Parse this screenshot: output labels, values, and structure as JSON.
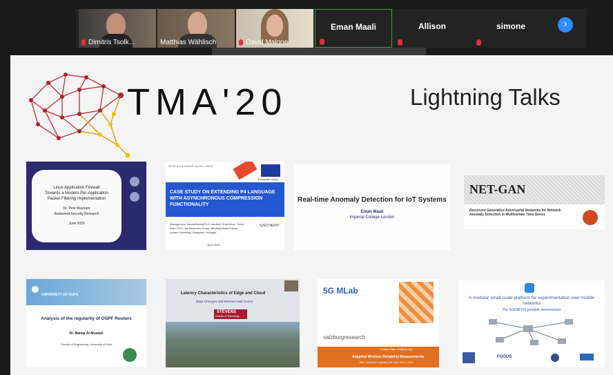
{
  "participants": [
    {
      "name": "Dimitris Tsolk..."
    },
    {
      "name": "Matthias Wählisch"
    },
    {
      "name": "David Malone"
    }
  ],
  "name_tiles": [
    {
      "name": "Eman Maali"
    },
    {
      "name": "Allison"
    },
    {
      "name": "simone"
    }
  ],
  "next_page_icon": "chevron-right-icon",
  "slide": {
    "logo_text": "TMA",
    "logo_year": "'20",
    "title": "Lightning Talks",
    "thumbs": {
      "t1": {
        "l1": "Linux Application Firewall",
        "l2": "Towards a Modern Per-Application",
        "l3": "Packet Filtering Implementation",
        "author": "Dr. Pete Maynard",
        "org": "Barbwired Security Research",
        "date": "June 2020"
      },
      "t2": {
        "header": "EFOP-3.6.3-VEKOP-16-2017-00001",
        "eu": "European Union",
        "title": "CASE STUDY ON EXTENDING P4 LANGUAGE WITH ASYNCHRONOUS COMPRESSION FUNCTIONALITY",
        "body": "Management Sándorffszkg(Ph.D. student) Supervisor: Tudor Ábel, Ph.D. 3th Research Group, Worldmedsdal Eötvös Loránd University, Budapest, Hungary",
        "date": "June 2020",
        "brand": "SZÉCHENYI"
      },
      "t3": {
        "title": "Real-time Anomaly Detection for IoT Systems",
        "author": "Eman Maali",
        "org": "Imperial College London"
      },
      "t4": {
        "title": "NET-GAN",
        "sub": "Recurrent Generative Adversarial Networks for Network Anomaly Detection in Multivariate Time-Series"
      },
      "t5": {
        "uni": "UNIVERSITY OF KUFA",
        "title": "Analysis of the regularity of OSPF Routers",
        "author": "Dr. Bahaa Al-Musawi",
        "org": "Faculty of Engineering, University of Kufa"
      },
      "t6": {
        "title": "Latency Characteristics of Edge and Cloud",
        "authors": "Batyr Charyyev and Mehmet Hadi Gunes",
        "logo": "STEVENS",
        "logo_sub": "Institute of Technology"
      },
      "t7": {
        "logo": "5G MLab",
        "org": "salzburgresearch",
        "presenter": "Christian Maier, Wolfgang Sigl",
        "bar": "Adaptive Wireless Reliability Measurements",
        "bar_sub": "TMA Conference Lightning Talk, June 19-21, 2020"
      },
      "t8": {
        "title": "A modular small-scale platform for experimentation over mobile networks",
        "sub": "The 5GENESIS portable demonstrator",
        "logos": [
          "FOGUS"
        ]
      }
    }
  }
}
